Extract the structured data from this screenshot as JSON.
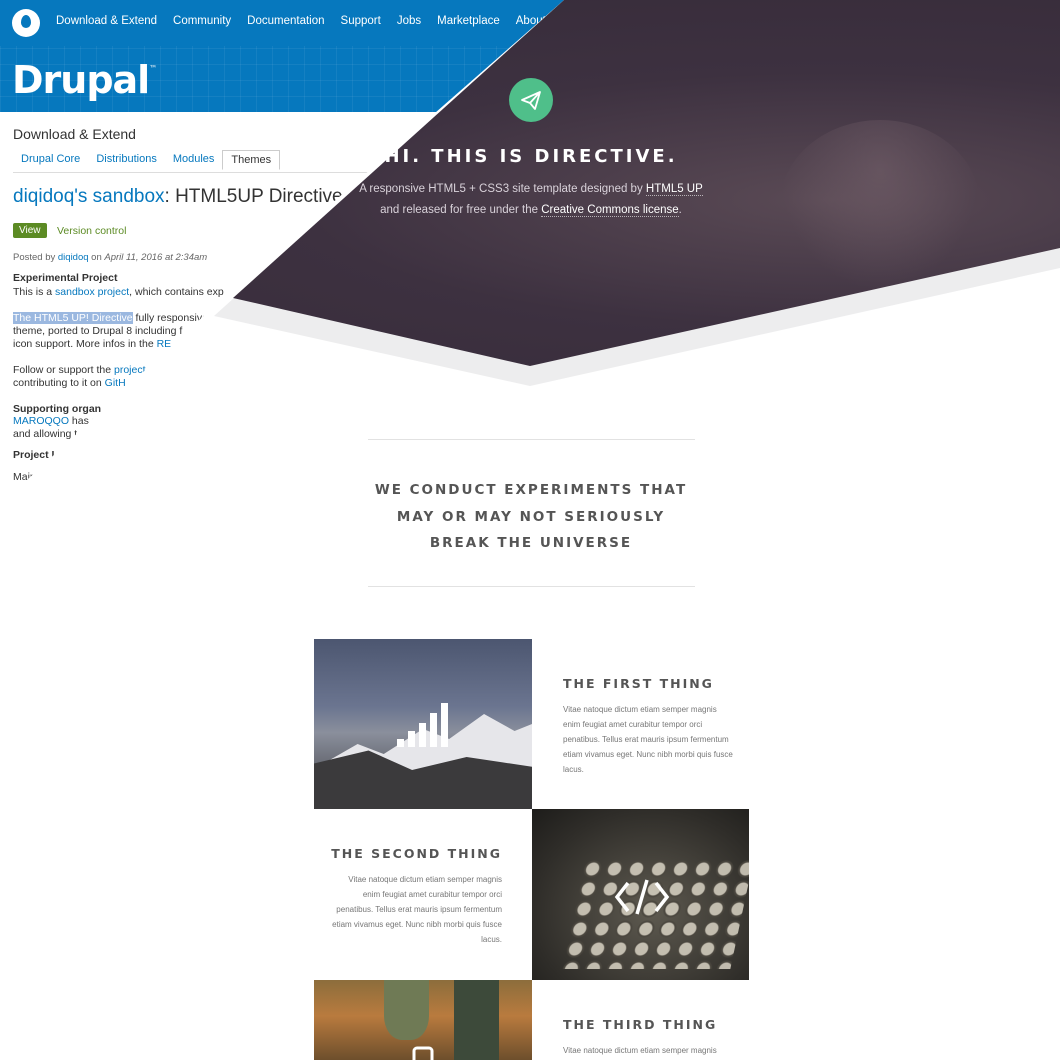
{
  "drupal": {
    "nav": [
      "Download & Extend",
      "Community",
      "Documentation",
      "Support",
      "Jobs",
      "Marketplace",
      "About"
    ],
    "logo": "Drupal",
    "logo_tm": "™",
    "section_title": "Download & Extend",
    "tabs": [
      "Drupal Core",
      "Distributions",
      "Modules",
      "Themes"
    ],
    "active_tab": "Themes",
    "project_owner": "diqidoq's sandbox",
    "project_title": ": HTML5UP Directive",
    "view_button": "View",
    "version_control": "Version control",
    "posted_prefix": "Posted by",
    "posted_author": "diqidoq",
    "posted_on": "on",
    "posted_date": "April 11, 2016 at 2:34am",
    "experimental_heading": "Experimental Project",
    "sandbox_line_a": "This is a",
    "sandbox_link": "sandbox project",
    "sandbox_line_b": ", which contains exp",
    "desc_highlight": "The HTML5 UP! Directive",
    "desc_a": " fully responsive",
    "desc_b": "theme, ported to Drupal 8 including f",
    "desc_c": "icon support. More infos in the",
    "desc_c_link": "RE",
    "follow_a": "Follow or support the",
    "follow_link": "project",
    "follow_b": "contributing to it on",
    "follow_b_link": "GitH",
    "supporting_heading": "Supporting organ",
    "maroqqo_link": "MAROQQO",
    "maroqqo_text": " has s",
    "allowing_text": "and allowing t",
    "project_heading": "Project I",
    "main_text": "Main"
  },
  "hero": {
    "icon": "paper-plane-icon",
    "title": "HI. THIS IS DIRECTIVE.",
    "sub_a": "A responsive HTML5 + CSS3 site template designed by",
    "sub_link_a": "HTML5 UP",
    "sub_b": "and released for free under the",
    "sub_link_b": "Creative Commons license",
    "sub_end": "."
  },
  "tagline": [
    "WE CONDUCT EXPERIMENTS THAT",
    "MAY OR MAY NOT SERIOUSLY",
    "BREAK THE UNIVERSE"
  ],
  "features": [
    {
      "title": "THE FIRST THING",
      "text": [
        "Vitae natoque dictum etiam semper magnis",
        "enim feugiat amet curabitur tempor orci",
        "penatibus. Tellus erat mauris ipsum fermentum",
        "etiam vivamus eget. Nunc nibh morbi quis fusce",
        "lacus."
      ],
      "icon": "signal-bars-icon"
    },
    {
      "title": "THE SECOND THING",
      "text": [
        "Vitae natoque dictum etiam semper magnis",
        "enim feugiat amet curabitur tempor orci",
        "penatibus. Tellus erat mauris ipsum fermentum",
        "etiam vivamus eget. Nunc nibh morbi quis fusce",
        "lacus."
      ],
      "icon": "code-icon"
    },
    {
      "title": "THE THIRD THING",
      "text": [
        "Vitae natoque dictum etiam semper magnis"
      ],
      "icon": "mobile-icon"
    }
  ],
  "colors": {
    "drupal_blue": "#0678be",
    "hero_bg": "#3d3140",
    "accent_green": "#4fbf8a",
    "drupal_green": "#5c8b24"
  }
}
